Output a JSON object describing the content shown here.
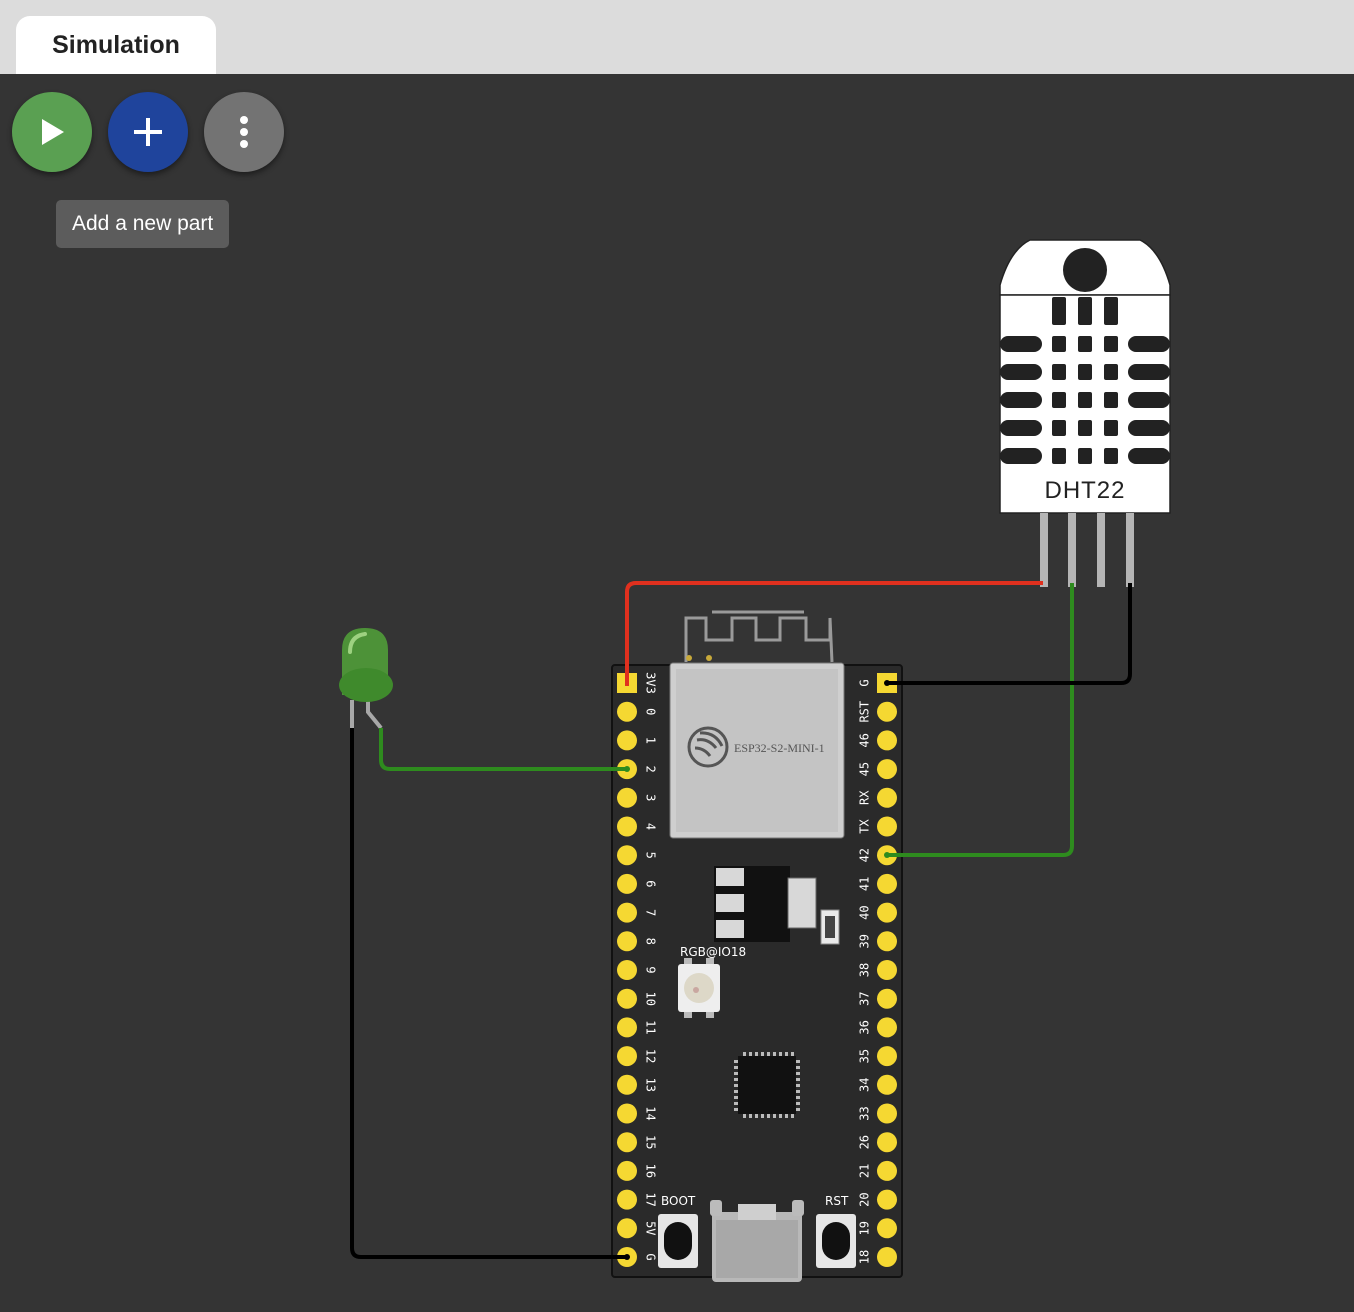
{
  "tabs": {
    "simulation_label": "Simulation"
  },
  "toolbar": {
    "play_icon": "play-icon",
    "add_icon": "plus-icon",
    "more_icon": "more-vertical-icon",
    "tooltip": "Add a new part"
  },
  "parts": {
    "sensor": {
      "label": "DHT22"
    },
    "board": {
      "module_label": "ESP32-S2-MINI-1",
      "rgb_label": "RGB@IO18",
      "boot_label": "BOOT",
      "rst_label": "RST",
      "left_pins": [
        "3V3",
        "0",
        "1",
        "2",
        "3",
        "4",
        "5",
        "6",
        "7",
        "8",
        "9",
        "10",
        "11",
        "12",
        "13",
        "14",
        "15",
        "16",
        "17",
        "5V",
        "G"
      ],
      "right_pins": [
        "G",
        "RST",
        "46",
        "45",
        "RX",
        "TX",
        "42",
        "41",
        "40",
        "39",
        "38",
        "37",
        "36",
        "35",
        "34",
        "33",
        "26",
        "21",
        "20",
        "19",
        "18"
      ]
    },
    "led": {
      "color": "green"
    }
  },
  "colors": {
    "canvas": "#343434",
    "wire_red": "#e0301e",
    "wire_green": "#2e8b1e",
    "wire_black": "#000000",
    "pin_yellow": "#f5d832"
  }
}
